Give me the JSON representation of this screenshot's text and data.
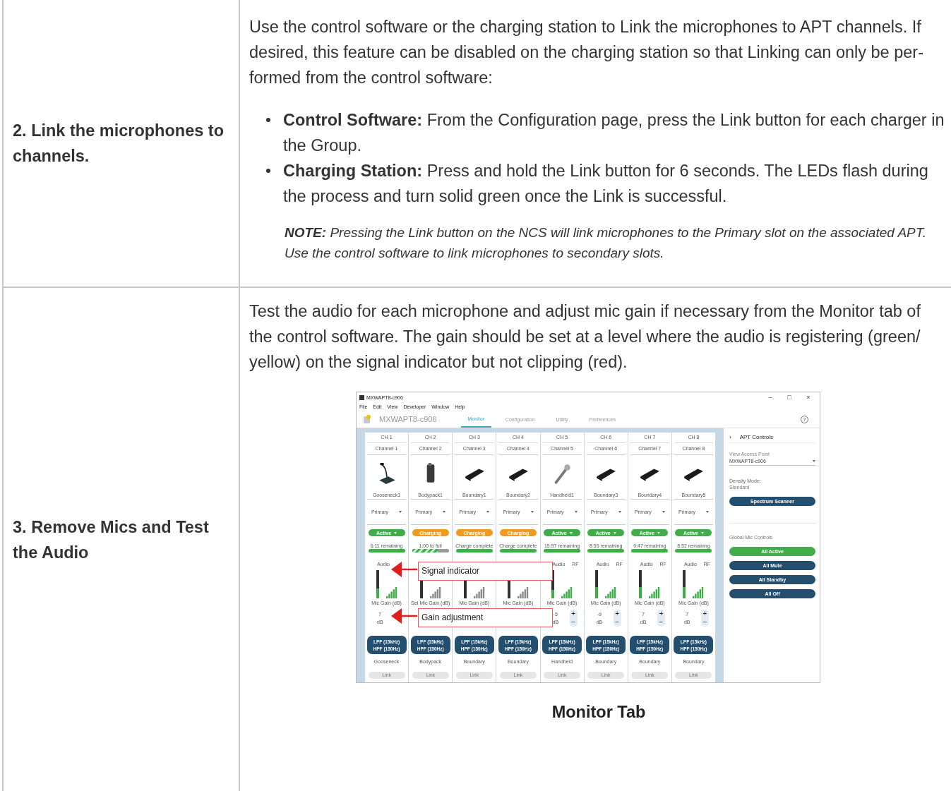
{
  "rows": [
    {
      "step": "2. Link the microphones to channels.",
      "paragraphs": [
        "Use the control software or the charging station to Link the microphones to APT channels. If desired, this feature can be disabled on the charging station so that Linking can only be per-formed from the control software:"
      ],
      "bullets": [
        "**Control Software:** From the Configuration page, press the Link button for each charger in the Group.",
        "**Charging Station:** Press and hold the Link button for 6 seconds. The LEDs flash during the process and turn solid green once the Link is successful."
      ],
      "note": "**NOTE:** Pressing the Link button on the NCS will link microphones to the Primary slot on the associated APT. Use the control software to link microphones to secondary slots."
    },
    {
      "step": "3. Remove Mics and Test the Audio",
      "paragraphs": [
        "Test the audio for each microphone and adjust mic gain if necessary from the Monitor tab of the control software. The gain should be set at a level where the audio is registering (green/ yellow) on the signal indicator but not clipping (red)."
      ],
      "figure": {
        "caption": "Monitor Tab",
        "app": {
          "title": "MXWAPT8-c906",
          "window_controls": [
            "–",
            "□",
            "×"
          ],
          "menu": [
            "File",
            "Edit",
            "View",
            "Developer",
            "Window",
            "Help"
          ],
          "device": "MXWAPT8-c906",
          "help": "?",
          "tabs": [
            {
              "label": "Monitor",
              "selected": true
            },
            {
              "label": "Configuration",
              "selected": false
            },
            {
              "label": "Utility",
              "selected": false
            },
            {
              "label": "Preferences",
              "selected": false
            }
          ],
          "channels": [
            {
              "ch": "CH 1",
              "name": "Channel 1",
              "kind": "gooseneck",
              "mic": "Gooseneck1",
              "slot": "Primary",
              "status": {
                "label": "Active",
                "kind": "active"
              },
              "battery_text": "6:11 remaining",
              "battery": {
                "level": 1,
                "charging": false
              },
              "audio_label": "Audio",
              "audio_meter": {
                "level": 0.35
              },
              "gain_label": "Mic Gain (dB)",
              "gain": "7",
              "unit": "dB",
              "filters": [
                "LPF (15kHz)",
                "HPF (150Hz)"
              ],
              "type": "Gooseneck",
              "link": "Link"
            },
            {
              "ch": "CH 2",
              "name": "Channel 2",
              "kind": "bodypack",
              "mic": "Bodypack1",
              "slot": "Primary",
              "status": {
                "label": "Charging",
                "kind": "charging"
              },
              "battery_text": "1:00 to full",
              "battery": {
                "level": 0.7,
                "charging": true
              },
              "gain_label": "Set Mic Gain (dB)",
              "filters": [
                "LPF (15kHz)",
                "HPF (150Hz)"
              ],
              "type": "Bodypack",
              "link": "Link"
            },
            {
              "ch": "CH 3",
              "name": "Channel 3",
              "kind": "boundary",
              "mic": "Boundary1",
              "slot": "Primary",
              "status": {
                "label": "Charging",
                "kind": "charging"
              },
              "battery_text": "Charge complete",
              "battery": {
                "level": 1,
                "charging": false
              },
              "gain_label": "Mic Gain (dB)",
              "filters": [
                "LPF (15kHz)",
                "HPF (150Hz)"
              ],
              "type": "Boundary",
              "link": "Link"
            },
            {
              "ch": "CH 4",
              "name": "Channel 4",
              "kind": "boundary",
              "mic": "Boundary2",
              "slot": "Primary",
              "status": {
                "label": "Charging",
                "kind": "charging"
              },
              "battery_text": "Charge complete",
              "battery": {
                "level": 1,
                "charging": false
              },
              "gain_label": "Mic Gain (dB)",
              "filters": [
                "LPF (15kHz)",
                "HPF (150Hz)"
              ],
              "type": "Boundary",
              "link": "Link"
            },
            {
              "ch": "CH 5",
              "name": "Channel 5",
              "kind": "handheld",
              "mic": "Handheld1",
              "slot": "Primary",
              "status": {
                "label": "Active",
                "kind": "active"
              },
              "battery_text": "15:57 remaining",
              "battery": {
                "level": 1,
                "charging": false
              },
              "audio_label": "Audio",
              "rf_label": "RF",
              "audio_meter": {
                "level": 0.3
              },
              "gain_label": "Mic Gain (dB)",
              "gain": "-5",
              "unit": "dB",
              "plus": "+",
              "minus": "−",
              "filters": [
                "LPF (15kHz)",
                "HPF (150Hz)"
              ],
              "type": "Handheld",
              "link": "Link"
            },
            {
              "ch": "CH 6",
              "name": "Channel 6",
              "kind": "boundary",
              "mic": "Boundary3",
              "slot": "Primary",
              "status": {
                "label": "Active",
                "kind": "active"
              },
              "battery_text": "8:55 remaining",
              "battery": {
                "level": 1,
                "charging": false
              },
              "audio_label": "Audio",
              "rf_label": "RF",
              "audio_meter": {
                "level": 0.4
              },
              "gain_label": "Mic Gain (dB)",
              "gain": "-9",
              "unit": "dB",
              "plus": "+",
              "minus": "−",
              "filters": [
                "LPF (15kHz)",
                "HPF (150Hz)"
              ],
              "type": "Boundary",
              "link": "Link"
            },
            {
              "ch": "CH 7",
              "name": "Channel 7",
              "kind": "boundary",
              "mic": "Boundary4",
              "slot": "Primary",
              "status": {
                "label": "Active",
                "kind": "active"
              },
              "battery_text": "0:47 remaining",
              "battery": {
                "level": 1,
                "charging": false
              },
              "audio_label": "Audio",
              "rf_label": "RF",
              "audio_meter": {
                "level": 0.4
              },
              "gain_label": "Mic Gain (dB)",
              "gain": "7",
              "unit": "dB",
              "plus": "+",
              "minus": "−",
              "filters": [
                "LPF (15kHz)",
                "HPF (150Hz)"
              ],
              "type": "Boundary",
              "link": "Link"
            },
            {
              "ch": "CH 8",
              "name": "Channel 8",
              "kind": "boundary",
              "mic": "Boundary5",
              "slot": "Primary",
              "status": {
                "label": "Active",
                "kind": "active"
              },
              "battery_text": "8:52 remaining",
              "battery": {
                "level": 1,
                "charging": false
              },
              "audio_label": "Audio",
              "rf_label": "RF",
              "audio_meter": {
                "level": 0.4
              },
              "gain_label": "Mic Gain (dB)",
              "gain": "7",
              "unit": "dB",
              "plus": "+",
              "minus": "−",
              "filters": [
                "LPF (15kHz)",
                "HPF (150Hz)"
              ],
              "type": "Boundary",
              "link": "Link"
            }
          ],
          "panel": {
            "chevron": "›",
            "title": "APT Controls",
            "ap_label": "View Access Point",
            "ap_value": "MXWAPT8-c906",
            "density_label": "Density Mode:",
            "density_value": "Standard",
            "scanner": "Spectrum Scanner",
            "global_label": "Global Mic Controls",
            "buttons": [
              {
                "label": "All Active",
                "kind": "active"
              },
              {
                "label": "All Mute",
                "kind": "normal"
              },
              {
                "label": "All Standby",
                "kind": "normal"
              },
              {
                "label": "All Off",
                "kind": "normal"
              }
            ]
          },
          "callouts": [
            {
              "label": "Signal indicator"
            },
            {
              "label": "Gain adjustment"
            }
          ]
        }
      }
    }
  ]
}
